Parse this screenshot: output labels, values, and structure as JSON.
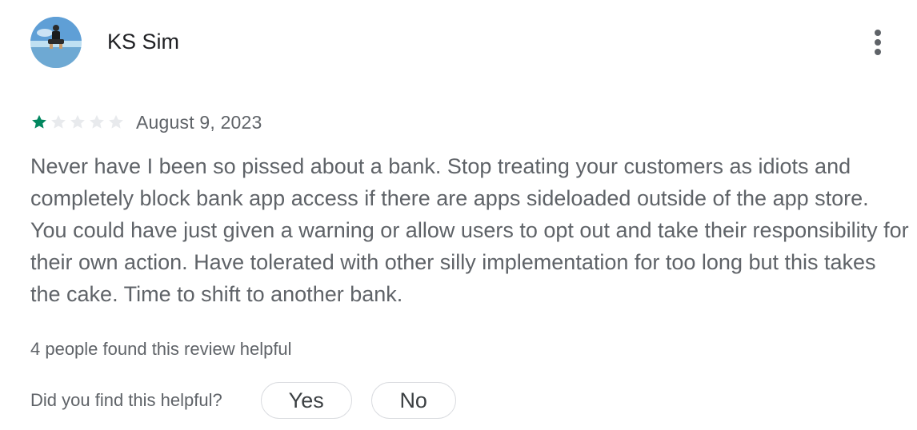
{
  "review": {
    "author": "KS Sim",
    "rating": 1,
    "max_rating": 5,
    "date": "August 9, 2023",
    "text": "Never have I been so pissed about a bank. Stop treating your customers as idiots and completely block bank app access if there are apps sideloaded outside of the app store. You could have just given a warning or allow users to opt out and take their responsibility for their own action. Have tolerated with other silly implementation for too long but this takes the cake. Time to shift to another bank.",
    "helpful_count_text": "4 people found this review helpful"
  },
  "feedback": {
    "question": "Did you find this helpful?",
    "yes_label": "Yes",
    "no_label": "No"
  },
  "icons": {
    "menu": "more-vert-icon",
    "star": "star-icon"
  },
  "colors": {
    "star_filled": "#01875f",
    "star_empty": "#e8eaed",
    "text_primary": "#202124",
    "text_secondary": "#5f6368",
    "button_border": "#dadce0"
  }
}
